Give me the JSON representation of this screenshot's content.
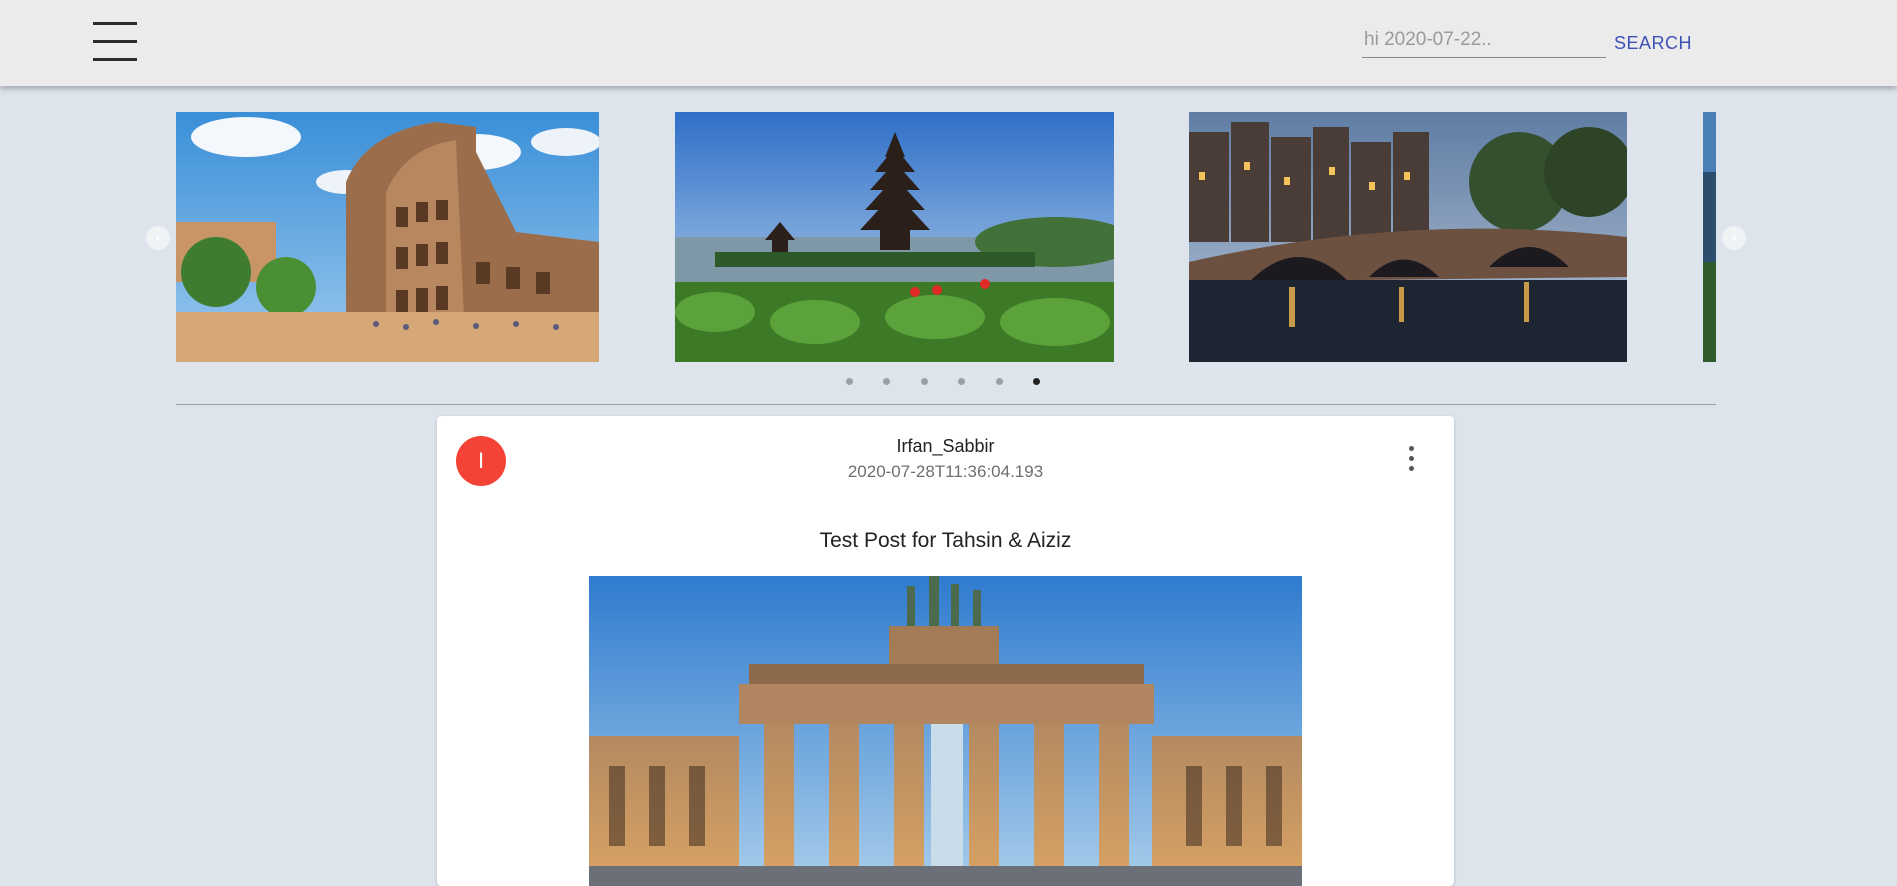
{
  "header": {
    "menu_icon": "hamburger-menu-icon",
    "search": {
      "placeholder": "hi 2020-07-22..",
      "value": "",
      "button_label": "SEARCH"
    }
  },
  "carousel": {
    "prev_icon": "chevron-left-icon",
    "next_icon": "chevron-right-icon",
    "slides": [
      "colosseum-photo",
      "temple-lake-photo",
      "canal-bridge-photo",
      "partial-photo"
    ],
    "dot_count": 6,
    "active_index": 5
  },
  "post": {
    "avatar_initial": "I",
    "avatar_color": "#f44336",
    "author": "Irfan_Sabbir",
    "timestamp": "2020-07-28T11:36:04.193",
    "more_icon": "more-vertical-icon",
    "text": "Test Post for Tahsin & Aiziz",
    "image": "brandenburg-gate-photo"
  },
  "colors": {
    "background": "#dde4ec",
    "header": "#ebebeb",
    "accent": "#3f51b5"
  }
}
